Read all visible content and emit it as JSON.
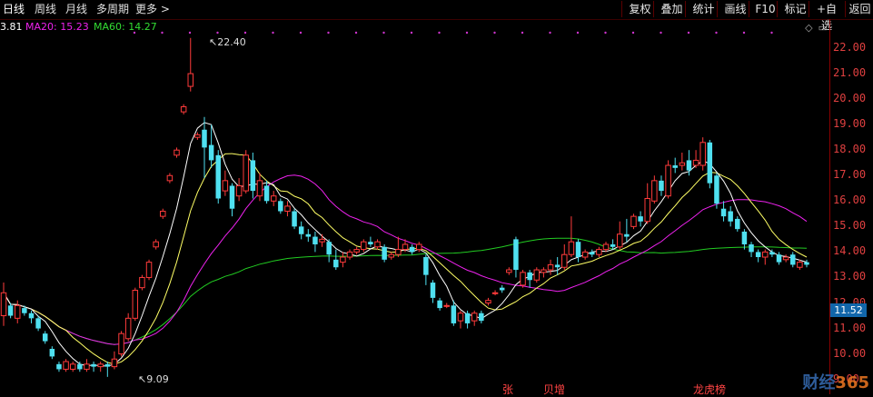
{
  "tabs": [
    {
      "label": "日线",
      "active": true
    },
    {
      "label": "周线"
    },
    {
      "label": "月线"
    },
    {
      "label": "多周期"
    },
    {
      "label": "更多 >"
    }
  ],
  "toolbar": [
    "复权",
    "叠加",
    "统计",
    "画线",
    "F10",
    "标记",
    "+自选",
    "返回"
  ],
  "ma": {
    "ma5": "3.81",
    "ma20": "MA20: 15.23",
    "ma60": "MA60: 14.27"
  },
  "colors": {
    "up": "#ff3b3b",
    "down": "#4fe0f0",
    "ma5": "#ffffff",
    "ma10": "#ffff66",
    "ma20": "#ee22ee",
    "ma60": "#22cc22"
  },
  "y_axis": [
    "22.00",
    "21.00",
    "20.00",
    "19.00",
    "18.00",
    "17.00",
    "16.00",
    "15.00",
    "14.00",
    "13.00",
    "12.00",
    "11.00",
    "10.00",
    "9.00"
  ],
  "current_price": "11.52",
  "annotations": {
    "high": "22.40",
    "low": "9.09"
  },
  "bottom_tags": [
    "张",
    "贝增",
    "龙虎榜"
  ],
  "watermark": {
    "text": "财经",
    "num": "365",
    "url": "www.caijing365.com"
  },
  "chart_data": {
    "type": "candlestick",
    "ylim": [
      9,
      22.6
    ],
    "candles": [
      [
        11.5,
        12.4,
        11.1,
        12.8
      ],
      [
        11.9,
        11.5,
        11.4,
        12.0
      ],
      [
        11.4,
        11.9,
        11.2,
        12.1
      ],
      [
        11.8,
        11.6,
        11.5,
        11.9
      ],
      [
        11.6,
        11.4,
        11.2,
        11.7
      ],
      [
        11.4,
        11.0,
        10.9,
        11.5
      ],
      [
        10.8,
        10.5,
        10.4,
        10.9
      ],
      [
        10.2,
        9.9,
        9.8,
        10.3
      ],
      [
        9.6,
        9.4,
        9.3,
        9.7
      ],
      [
        9.4,
        9.7,
        9.3,
        9.8
      ],
      [
        9.4,
        9.6,
        9.3,
        9.7
      ],
      [
        9.6,
        9.4,
        9.3,
        9.7
      ],
      [
        9.4,
        9.6,
        9.3,
        9.8
      ],
      [
        9.6,
        9.5,
        9.3,
        9.7
      ],
      [
        9.5,
        9.6,
        9.3,
        9.7
      ],
      [
        9.6,
        9.5,
        9.1,
        9.7
      ],
      [
        9.5,
        9.8,
        9.4,
        10.1
      ],
      [
        10.0,
        10.8,
        9.9,
        10.9
      ],
      [
        10.6,
        11.4,
        10.5,
        11.6
      ],
      [
        11.4,
        12.5,
        11.3,
        12.6
      ],
      [
        12.6,
        13.0,
        12.5,
        13.1
      ],
      [
        13.0,
        13.6,
        12.9,
        13.7
      ],
      [
        14.2,
        14.4,
        14.1,
        14.5
      ],
      [
        15.4,
        15.6,
        15.3,
        15.7
      ],
      [
        16.8,
        17.0,
        16.7,
        17.1
      ],
      [
        17.8,
        18.0,
        17.7,
        18.1
      ],
      [
        19.5,
        19.7,
        19.4,
        19.8
      ],
      [
        20.5,
        21.0,
        20.3,
        22.4
      ],
      [
        18.5,
        18.6,
        18.4,
        18.7
      ],
      [
        18.8,
        18.1,
        16.9,
        19.3
      ],
      [
        18.2,
        17.6,
        17.3,
        19.0
      ],
      [
        17.8,
        16.1,
        15.9,
        18.0
      ],
      [
        16.4,
        16.8,
        16.2,
        17.2
      ],
      [
        16.6,
        15.7,
        15.4,
        16.7
      ],
      [
        16.2,
        16.6,
        16.0,
        16.9
      ],
      [
        16.4,
        17.8,
        16.3,
        18.0
      ],
      [
        17.6,
        16.4,
        16.1,
        17.9
      ],
      [
        16.2,
        16.8,
        16.0,
        17.1
      ],
      [
        16.6,
        16.0,
        15.9,
        16.8
      ],
      [
        16.0,
        16.2,
        15.8,
        16.4
      ],
      [
        16.0,
        15.6,
        15.5,
        16.1
      ],
      [
        15.6,
        15.8,
        15.4,
        16.0
      ],
      [
        15.6,
        15.0,
        14.9,
        15.7
      ],
      [
        15.0,
        14.7,
        14.5,
        15.2
      ],
      [
        14.7,
        14.6,
        14.4,
        14.9
      ],
      [
        14.6,
        14.3,
        14.0,
        14.8
      ],
      [
        14.4,
        14.5,
        14.2,
        14.7
      ],
      [
        14.4,
        13.9,
        13.6,
        14.5
      ],
      [
        13.7,
        13.4,
        13.3,
        14.1
      ],
      [
        13.6,
        13.8,
        13.4,
        14.0
      ],
      [
        13.8,
        14.0,
        13.7,
        14.1
      ],
      [
        14.0,
        14.1,
        13.9,
        14.2
      ],
      [
        14.1,
        14.4,
        14.0,
        14.5
      ],
      [
        14.4,
        14.3,
        14.2,
        14.6
      ],
      [
        14.2,
        14.4,
        14.1,
        14.5
      ],
      [
        14.2,
        13.7,
        13.6,
        14.3
      ],
      [
        13.8,
        13.9,
        13.7,
        14.0
      ],
      [
        13.9,
        14.1,
        13.8,
        14.6
      ],
      [
        14.1,
        14.3,
        14.0,
        14.5
      ],
      [
        14.2,
        14.0,
        13.9,
        14.3
      ],
      [
        14.1,
        14.3,
        14.0,
        14.4
      ],
      [
        13.8,
        13.1,
        12.7,
        13.9
      ],
      [
        12.8,
        12.2,
        12.0,
        12.9
      ],
      [
        12.1,
        11.8,
        11.7,
        12.2
      ],
      [
        11.9,
        11.9,
        11.8,
        12.0
      ],
      [
        11.9,
        11.2,
        11.1,
        12.1
      ],
      [
        11.3,
        11.6,
        11.0,
        11.7
      ],
      [
        11.6,
        11.2,
        11.0,
        11.7
      ],
      [
        11.3,
        11.6,
        11.1,
        11.7
      ],
      [
        11.6,
        11.3,
        11.2,
        11.7
      ],
      [
        12.0,
        12.1,
        11.9,
        12.2
      ],
      [
        12.4,
        12.4,
        12.3,
        12.5
      ],
      [
        12.6,
        12.5,
        12.4,
        12.7
      ],
      [
        13.2,
        13.3,
        13.1,
        13.4
      ],
      [
        14.5,
        13.3,
        13.0,
        14.6
      ],
      [
        12.7,
        13.2,
        12.6,
        13.3
      ],
      [
        13.2,
        12.9,
        12.6,
        13.3
      ],
      [
        12.9,
        13.3,
        12.8,
        13.4
      ],
      [
        13.2,
        13.3,
        13.0,
        13.4
      ],
      [
        13.3,
        13.5,
        13.1,
        13.7
      ],
      [
        13.5,
        13.4,
        13.1,
        13.8
      ],
      [
        13.4,
        13.9,
        13.3,
        14.3
      ],
      [
        13.9,
        14.4,
        13.8,
        15.4
      ],
      [
        14.4,
        13.8,
        13.6,
        14.5
      ],
      [
        13.8,
        14.0,
        13.7,
        14.1
      ],
      [
        14.0,
        13.9,
        13.8,
        14.1
      ],
      [
        13.9,
        14.1,
        13.8,
        14.2
      ],
      [
        14.1,
        14.3,
        14.0,
        14.4
      ],
      [
        14.3,
        14.2,
        14.1,
        14.5
      ],
      [
        14.2,
        14.7,
        14.1,
        15.2
      ],
      [
        14.7,
        14.6,
        14.4,
        15.3
      ],
      [
        15.0,
        15.4,
        14.9,
        15.5
      ],
      [
        15.4,
        15.2,
        15.0,
        15.6
      ],
      [
        15.2,
        16.1,
        15.1,
        16.7
      ],
      [
        16.0,
        16.8,
        15.9,
        17.0
      ],
      [
        16.8,
        16.4,
        16.2,
        17.0
      ],
      [
        16.2,
        17.4,
        16.1,
        17.6
      ],
      [
        17.4,
        17.3,
        17.1,
        17.7
      ],
      [
        17.4,
        17.5,
        17.2,
        17.9
      ],
      [
        17.6,
        17.2,
        17.0,
        18.0
      ],
      [
        17.4,
        17.6,
        17.3,
        18.0
      ],
      [
        17.4,
        18.3,
        17.2,
        18.5
      ],
      [
        18.3,
        16.7,
        16.5,
        18.4
      ],
      [
        17.0,
        15.9,
        15.7,
        17.1
      ],
      [
        15.7,
        15.4,
        15.2,
        16.0
      ],
      [
        15.6,
        15.2,
        15.0,
        15.8
      ],
      [
        15.3,
        14.9,
        14.8,
        15.4
      ],
      [
        14.8,
        14.3,
        14.1,
        14.9
      ],
      [
        14.3,
        14.0,
        13.8,
        14.4
      ],
      [
        14.0,
        13.8,
        13.6,
        14.1
      ],
      [
        13.8,
        14.0,
        13.5,
        14.1
      ],
      [
        14.0,
        13.9,
        13.8,
        14.1
      ],
      [
        13.9,
        13.6,
        13.5,
        14.0
      ],
      [
        13.7,
        13.8,
        13.6,
        13.9
      ],
      [
        13.9,
        13.5,
        13.4,
        14.0
      ],
      [
        13.4,
        13.6,
        13.3,
        13.7
      ],
      [
        13.6,
        13.5,
        13.4,
        13.7
      ]
    ]
  }
}
